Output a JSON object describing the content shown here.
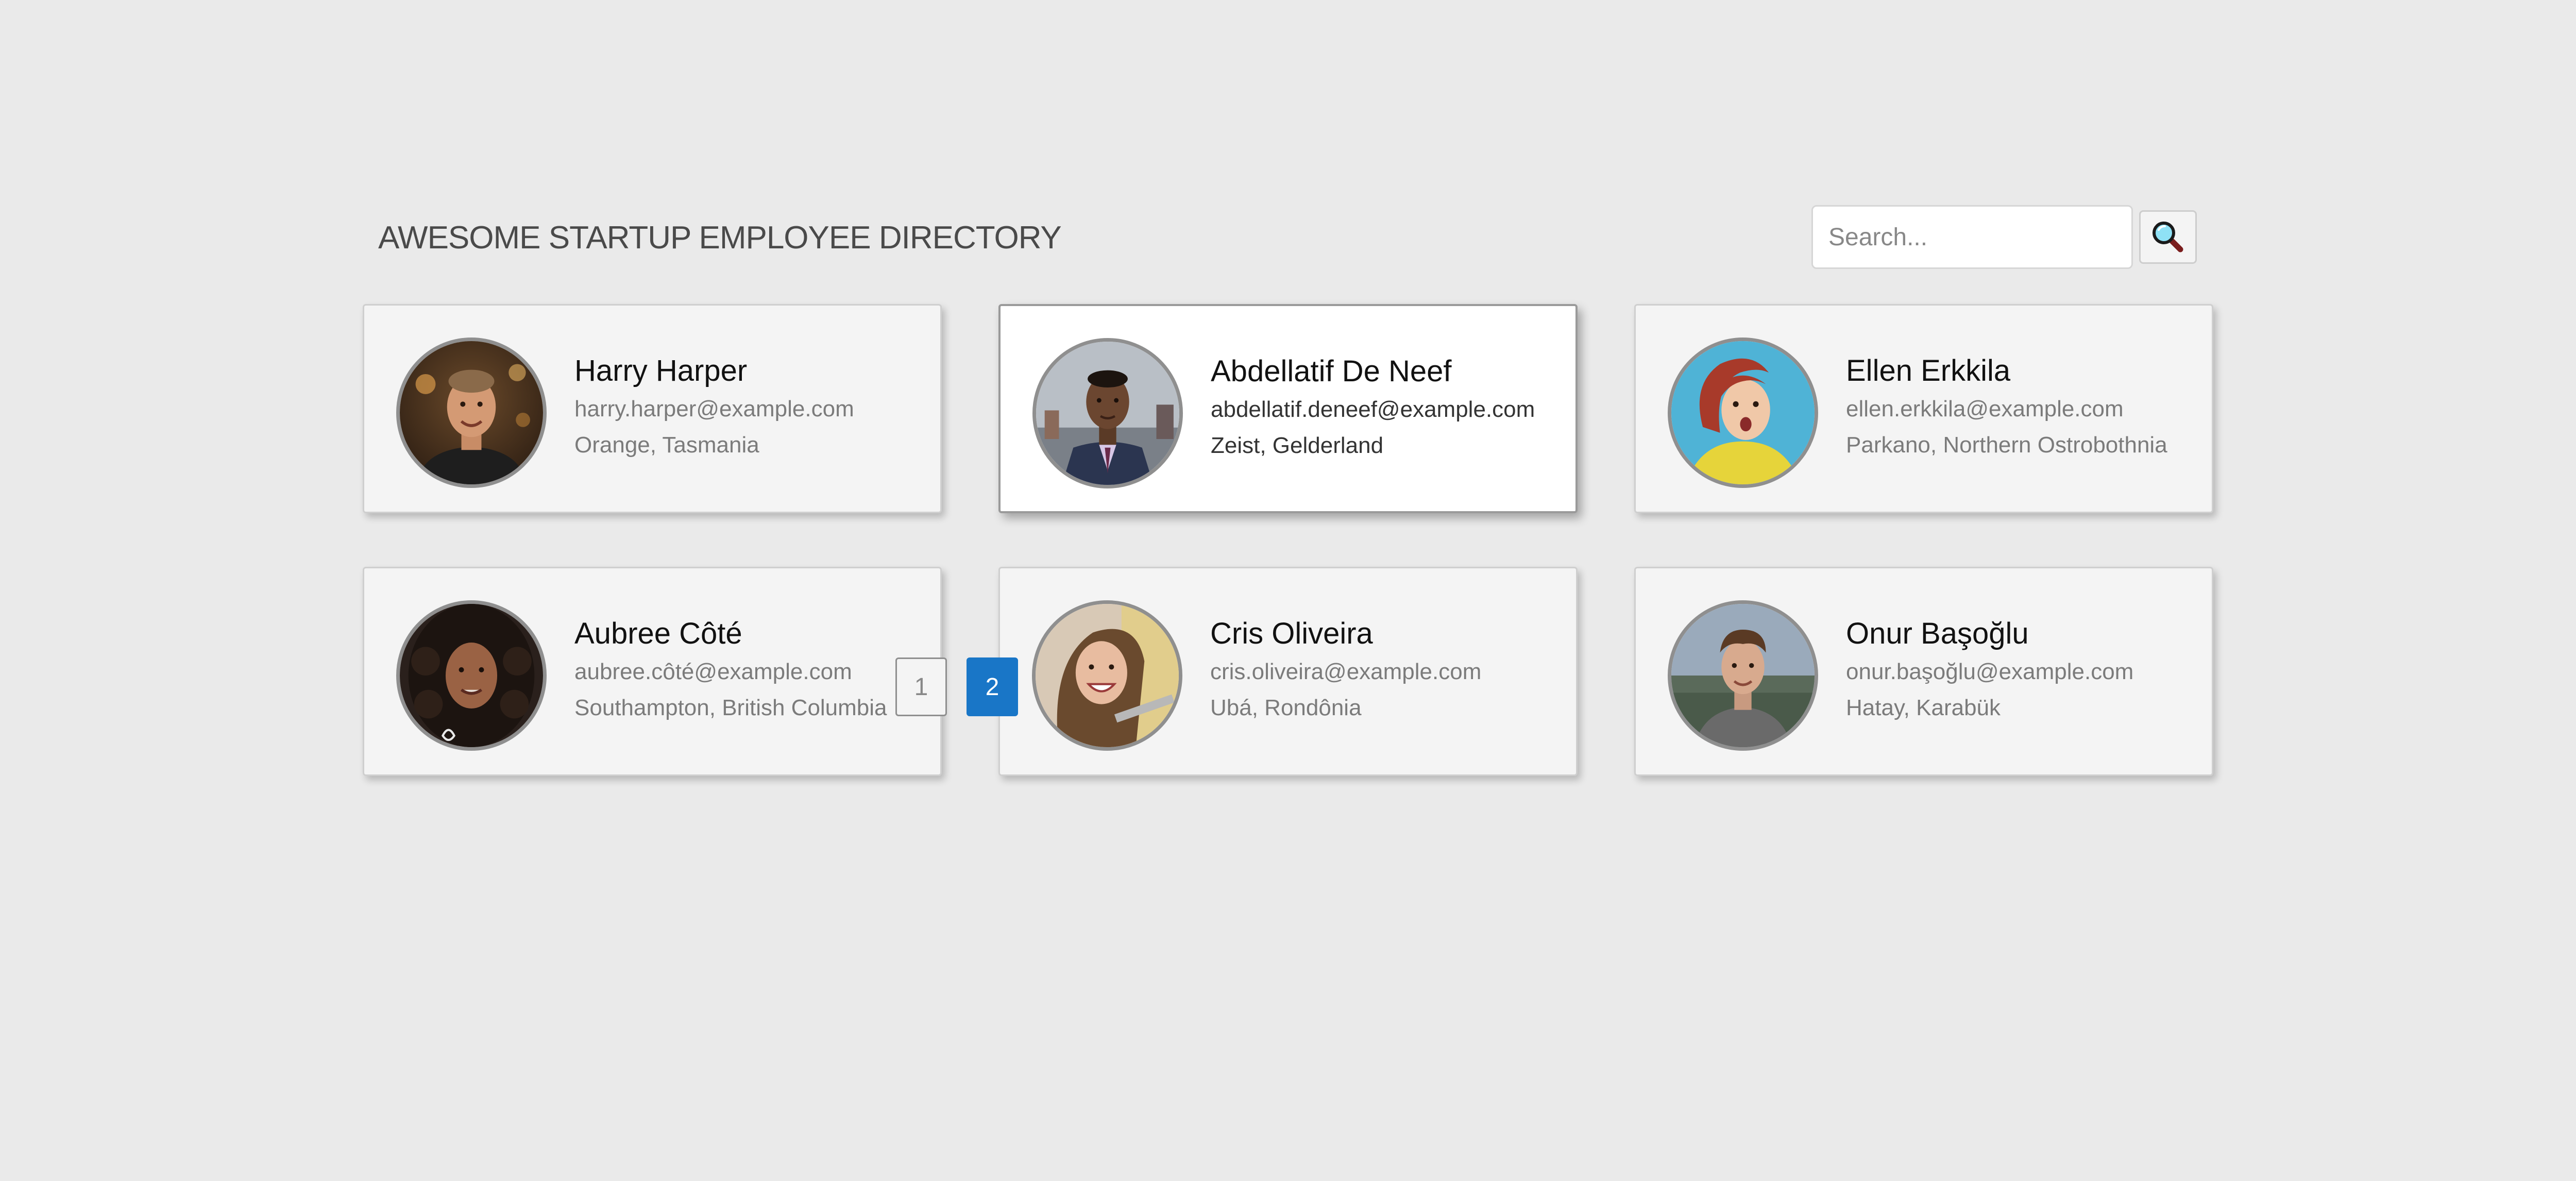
{
  "header": {
    "title": "AWESOME STARTUP EMPLOYEE DIRECTORY"
  },
  "search": {
    "placeholder": "Search...",
    "value": "",
    "button_icon": "magnifying-glass-icon"
  },
  "employees": [
    {
      "name": "Harry Harper",
      "email": "harry.harper@example.com",
      "location": "Orange, Tasmania",
      "active": false
    },
    {
      "name": "Abdellatif De Neef",
      "email": "abdellatif.deneef@example.com",
      "location": "Zeist, Gelderland",
      "active": true
    },
    {
      "name": "Ellen Erkkila",
      "email": "ellen.erkkila@example.com",
      "location": "Parkano, Northern Ostrobothnia",
      "active": false
    },
    {
      "name": "Aubree Côté",
      "email": "aubree.côté@example.com",
      "location": "Southampton, British Columbia",
      "active": false
    },
    {
      "name": "Cris Oliveira",
      "email": "cris.oliveira@example.com",
      "location": "Ubá, Rondônia",
      "active": false
    },
    {
      "name": "Onur Başoğlu",
      "email": "onur.başoğlu@example.com",
      "location": "Hatay, Karabük",
      "active": false
    }
  ],
  "pagination": {
    "pages": [
      "1",
      "2"
    ],
    "current": "2"
  },
  "colors": {
    "background": "#eaeaea",
    "accent": "#1976c7"
  }
}
